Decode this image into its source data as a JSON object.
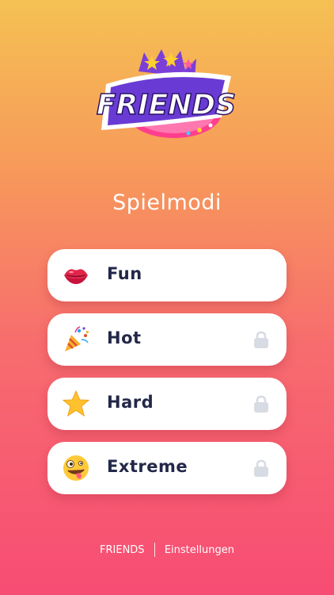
{
  "logo": {
    "text": "FRIENDS"
  },
  "heading": "Spielmodi",
  "modes": [
    {
      "label": "Fun",
      "icon": "lips-icon",
      "locked": false
    },
    {
      "label": "Hot",
      "icon": "party-popper-icon",
      "locked": true
    },
    {
      "label": "Hard",
      "icon": "star-icon",
      "locked": true
    },
    {
      "label": "Extreme",
      "icon": "zany-face-icon",
      "locked": true
    }
  ],
  "footer": {
    "brand": "FRIENDS",
    "settings": "Einstellungen"
  },
  "colors": {
    "gradient_top": "#f5c153",
    "gradient_bottom": "#f74c74",
    "card_bg": "#ffffff",
    "label_text": "#232848",
    "lock_gray": "#d7dbe3"
  }
}
